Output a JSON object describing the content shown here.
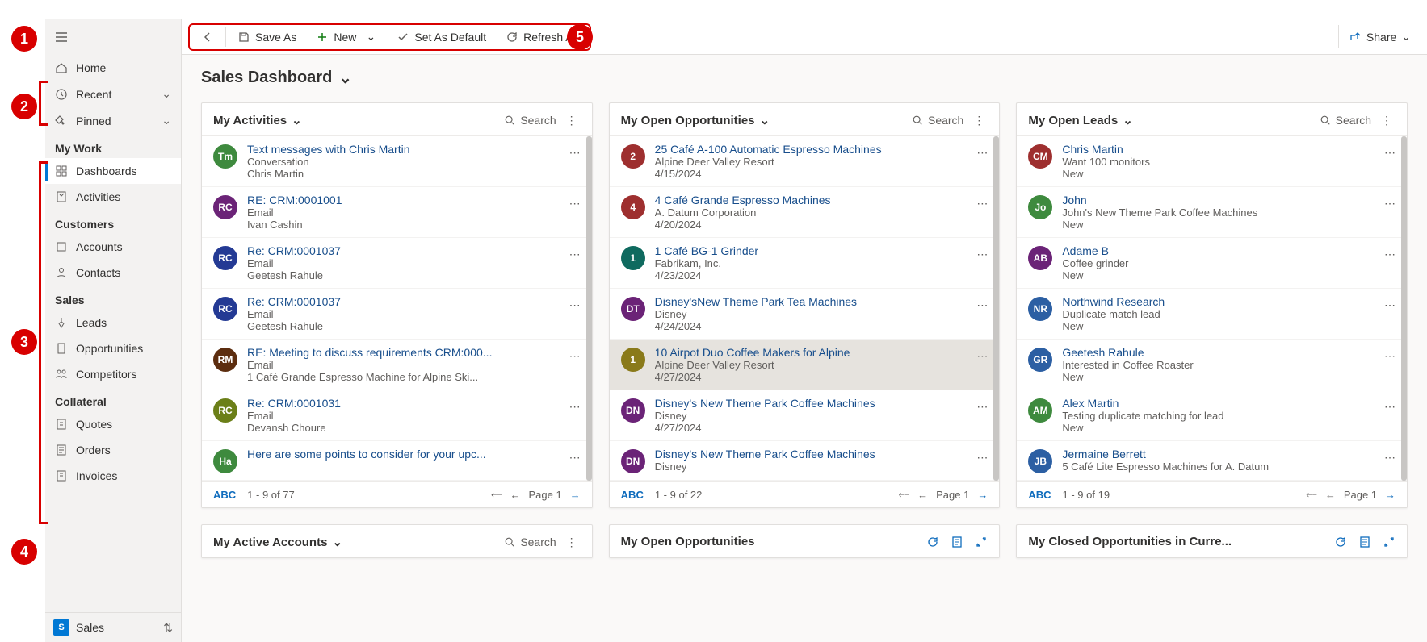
{
  "toolbar": {
    "saveAs": "Save As",
    "new": "New",
    "setDefault": "Set As Default",
    "refreshAll": "Refresh All",
    "share": "Share"
  },
  "sidebar": {
    "home": "Home",
    "recent": "Recent",
    "pinned": "Pinned",
    "groups": {
      "myWork": "My Work",
      "customers": "Customers",
      "sales": "Sales",
      "collateral": "Collateral"
    },
    "items": {
      "dashboards": "Dashboards",
      "activities": "Activities",
      "accounts": "Accounts",
      "contacts": "Contacts",
      "leads": "Leads",
      "opportunities": "Opportunities",
      "competitors": "Competitors",
      "quotes": "Quotes",
      "orders": "Orders",
      "invoices": "Invoices"
    },
    "footer": {
      "badge": "S",
      "label": "Sales"
    }
  },
  "page": {
    "title": "Sales Dashboard"
  },
  "cards": {
    "activities": {
      "title": "My Activities",
      "search": "Search",
      "abc": "ABC",
      "count": "1 - 9 of 77",
      "page": "Page 1",
      "rows": [
        {
          "av": "Tm",
          "avc": "#3e8a3e",
          "l1": "Text messages with Chris Martin",
          "l2": "Conversation",
          "l3": "Chris Martin"
        },
        {
          "av": "RC",
          "avc": "#6b2377",
          "l1": "RE: CRM:0001001",
          "l2": "Email",
          "l3": "Ivan Cashin"
        },
        {
          "av": "RC",
          "avc": "#243a94",
          "l1": "Re: CRM:0001037",
          "l2": "Email",
          "l3": "Geetesh Rahule"
        },
        {
          "av": "RC",
          "avc": "#243a94",
          "l1": "Re: CRM:0001037",
          "l2": "Email",
          "l3": "Geetesh Rahule"
        },
        {
          "av": "RM",
          "avc": "#5c2d0f",
          "l1": "RE: Meeting to discuss requirements CRM:000...",
          "l2": "Email",
          "l3": "1 Café Grande Espresso Machine for Alpine Ski..."
        },
        {
          "av": "RC",
          "avc": "#6b7f18",
          "l1": "Re: CRM:0001031",
          "l2": "Email",
          "l3": "Devansh Choure"
        },
        {
          "av": "Ha",
          "avc": "#3e8a3e",
          "l1": "Here are some points to consider for your upc...",
          "l2": "",
          "l3": ""
        }
      ]
    },
    "opportunities": {
      "title": "My Open Opportunities",
      "search": "Search",
      "abc": "ABC",
      "count": "1 - 9 of 22",
      "page": "Page 1",
      "rows": [
        {
          "av": "2",
          "avc": "#9e2f2f",
          "l1": "25 Café A-100 Automatic Espresso Machines",
          "l2": "Alpine Deer Valley Resort",
          "l3": "4/15/2024"
        },
        {
          "av": "4",
          "avc": "#9e2f2f",
          "l1": "4 Café Grande Espresso Machines",
          "l2": "A. Datum Corporation",
          "l3": "4/20/2024"
        },
        {
          "av": "1",
          "avc": "#0f6a5f",
          "l1": "1 Café BG-1 Grinder",
          "l2": "Fabrikam, Inc.",
          "l3": "4/23/2024"
        },
        {
          "av": "DT",
          "avc": "#6b2377",
          "l1": "Disney'sNew Theme Park Tea Machines",
          "l2": "Disney",
          "l3": "4/24/2024"
        },
        {
          "av": "1",
          "avc": "#8a7a1a",
          "l1": "10 Airpot Duo Coffee Makers for Alpine",
          "l2": "Alpine Deer Valley Resort",
          "l3": "4/27/2024",
          "selected": true
        },
        {
          "av": "DN",
          "avc": "#6b2377",
          "l1": "Disney's New Theme Park Coffee Machines",
          "l2": "Disney",
          "l3": "4/27/2024"
        },
        {
          "av": "DN",
          "avc": "#6b2377",
          "l1": "Disney's New Theme Park Coffee Machines",
          "l2": "Disney",
          "l3": ""
        }
      ]
    },
    "leads": {
      "title": "My Open Leads",
      "search": "Search",
      "abc": "ABC",
      "count": "1 - 9 of 19",
      "page": "Page 1",
      "rows": [
        {
          "av": "CM",
          "avc": "#9e2f2f",
          "l1": "Chris Martin",
          "l2": "Want 100 monitors",
          "l3": "New"
        },
        {
          "av": "Jo",
          "avc": "#3e8a3e",
          "l1": "John",
          "l2": "John's New Theme Park Coffee Machines",
          "l3": "New"
        },
        {
          "av": "AB",
          "avc": "#6b2377",
          "l1": "Adame B",
          "l2": "Coffee grinder",
          "l3": "New"
        },
        {
          "av": "NR",
          "avc": "#2c5fa3",
          "l1": "Northwind Research",
          "l2": "Duplicate match lead",
          "l3": "New"
        },
        {
          "av": "GR",
          "avc": "#2c5fa3",
          "l1": "Geetesh Rahule",
          "l2": "Interested in Coffee Roaster",
          "l3": "New"
        },
        {
          "av": "AM",
          "avc": "#3e8a3e",
          "l1": "Alex Martin",
          "l2": "Testing duplicate matching for lead",
          "l3": "New"
        },
        {
          "av": "JB",
          "avc": "#2c5fa3",
          "l1": "Jermaine Berrett",
          "l2": "5 Café Lite Espresso Machines for A. Datum",
          "l3": ""
        }
      ]
    },
    "activeAccounts": {
      "title": "My Active Accounts",
      "search": "Search"
    },
    "openOpps2": {
      "title": "My Open Opportunities"
    },
    "closedOpps": {
      "title": "My Closed Opportunities in Curre..."
    }
  }
}
